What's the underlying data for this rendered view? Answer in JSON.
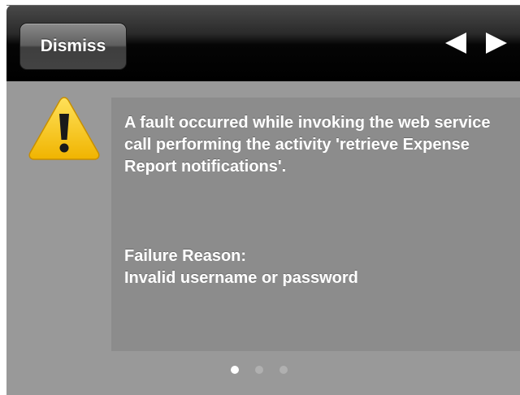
{
  "toolbar": {
    "dismiss_label": "Dismiss",
    "prev_icon": "left-arrow-icon",
    "next_icon": "right-arrow-icon"
  },
  "alert": {
    "icon": "warning-icon",
    "message": "A fault occurred while invoking the web service call performing the activity 'retrieve Expense Report notifications'.",
    "failure_label": "Failure Reason:",
    "failure_reason": "Invalid username or password"
  },
  "pager": {
    "total": 3,
    "active_index": 0
  },
  "colors": {
    "content_background": "#999999",
    "panel_background": "#8c8c8c",
    "toolbar_background": "#000000",
    "warning_yellow": "#f5c21b",
    "text": "#ffffff"
  }
}
